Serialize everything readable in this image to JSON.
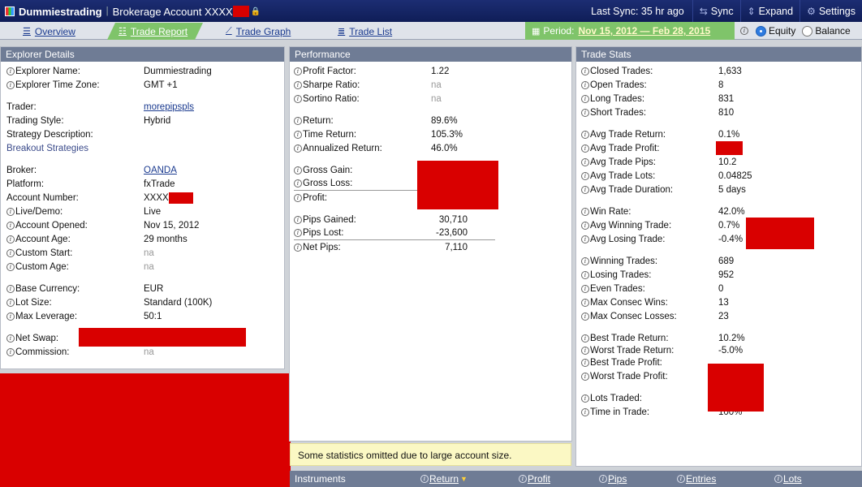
{
  "header": {
    "app_name": "Dummiestrading",
    "account": "Brokerage Account XXXX",
    "last_sync": "Last Sync: 35 hr ago",
    "sync": "Sync",
    "expand": "Expand",
    "settings": "Settings"
  },
  "tabs": {
    "overview": "Overview",
    "trade_report": "Trade Report",
    "trade_graph": "Trade Graph",
    "trade_list": "Trade List",
    "period_label": "Period:",
    "period_dates": "Nov 15, 2012 — Feb 28, 2015",
    "equity": "Equity",
    "balance": "Balance"
  },
  "explorer": {
    "title": "Explorer Details",
    "name_label": "Explorer Name:",
    "name": "Dummiestrading",
    "tz_label": "Explorer Time Zone:",
    "tz": "GMT +1",
    "trader_label": "Trader:",
    "trader": "morepipspls",
    "style_label": "Trading Style:",
    "style": "Hybrid",
    "desc_label": "Strategy Description:",
    "desc": "Breakout Strategies",
    "broker_label": "Broker:",
    "broker": "OANDA",
    "platform_label": "Platform:",
    "platform": "fxTrade",
    "acctnum_label": "Account Number:",
    "acctnum": "XXXX",
    "live_label": "Live/Demo:",
    "live": "Live",
    "opened_label": "Account Opened:",
    "opened": "Nov 15, 2012",
    "age_label": "Account Age:",
    "age": "29 months",
    "cstart_label": "Custom Start:",
    "cstart": "na",
    "cage_label": "Custom Age:",
    "cage": "na",
    "currency_label": "Base Currency:",
    "currency": "EUR",
    "lot_label": "Lot Size:",
    "lot": "Standard (100K)",
    "lev_label": "Max Leverage:",
    "lev": "50:1",
    "swap_label": "Net Swap:",
    "comm_label": "Commission:",
    "comm": "na"
  },
  "performance": {
    "title": "Performance",
    "pf_label": "Profit Factor:",
    "pf": "1.22",
    "sharpe_label": "Sharpe Ratio:",
    "sharpe": "na",
    "sortino_label": "Sortino Ratio:",
    "sortino": "na",
    "return_label": "Return:",
    "return": "89.6%",
    "tret_label": "Time Return:",
    "tret": "105.3%",
    "aret_label": "Annualized Return:",
    "aret": "46.0%",
    "gain_label": "Gross Gain:",
    "loss_label": "Gross Loss:",
    "profit_label": "Profit:",
    "pgain_label": "Pips Gained:",
    "pgain": "30,710",
    "plost_label": "Pips Lost:",
    "plost": "-23,600",
    "pnet_label": "Net Pips:",
    "pnet": "7,110",
    "notice": "Some statistics omitted due to large account size."
  },
  "stats": {
    "title": "Trade Stats",
    "closed_label": "Closed Trades:",
    "closed": "1,633",
    "open_label": "Open Trades:",
    "open": "8",
    "long_label": "Long Trades:",
    "long": "831",
    "short_label": "Short Trades:",
    "short": "810",
    "avgret_label": "Avg Trade Return:",
    "avgret": "0.1%",
    "avgprof_label": "Avg Trade Profit:",
    "avgpips_label": "Avg Trade Pips:",
    "avgpips": "10.2",
    "avglots_label": "Avg Trade Lots:",
    "avglots": "0.04825",
    "avgdur_label": "Avg Trade Duration:",
    "avgdur": "5 days",
    "winrate_label": "Win Rate:",
    "winrate": "42.0%",
    "avgwin_label": "Avg Winning Trade:",
    "avgwin": "0.7%",
    "avglose_label": "Avg Losing Trade:",
    "avglose": "-0.4%",
    "wins_label": "Winning Trades:",
    "wins": "689",
    "losses_label": "Losing Trades:",
    "losses": "952",
    "even_label": "Even Trades:",
    "even": "0",
    "cwins_label": "Max Consec Wins:",
    "cwins": "13",
    "closs_label": "Max Consec Losses:",
    "closs": "23",
    "best_label": "Best Trade Return:",
    "best": "10.2%",
    "worst_label": "Worst Trade Return:",
    "worst": "-5.0%",
    "bestp_label": "Best Trade Profit:",
    "worstp_label": "Worst Trade Profit:",
    "lots_label": "Lots Traded:",
    "time_label": "Time in Trade:",
    "time": "100%"
  },
  "instruments": {
    "title": "Instruments",
    "return": "Return",
    "profit": "Profit",
    "pips": "Pips",
    "entries": "Entries",
    "lots": "Lots"
  },
  "colors": {
    "redaction": "#d90000",
    "accent_green": "#7fc46a",
    "header_navy": "#0f1d57"
  }
}
